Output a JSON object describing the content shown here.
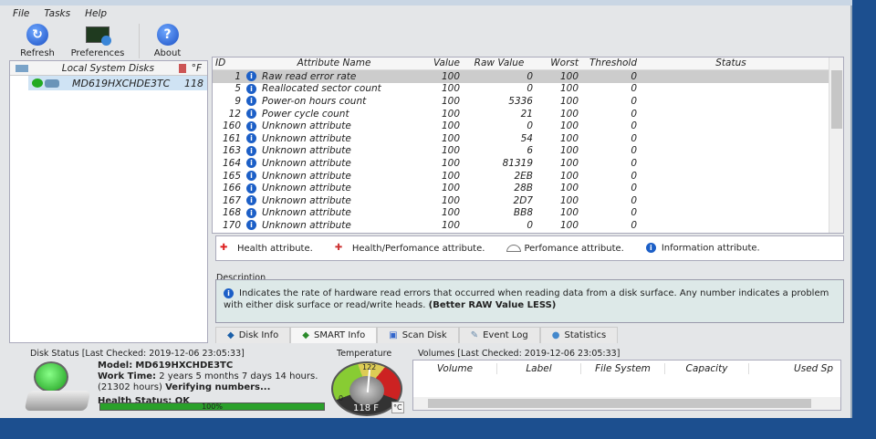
{
  "menu": [
    "File",
    "Tasks",
    "Help"
  ],
  "toolbar": {
    "refresh": "Refresh",
    "preferences": "Preferences",
    "about": "About"
  },
  "disks": {
    "header": "Local System Disks",
    "temp_unit": "°F",
    "items": [
      {
        "name": "MD619HXCHDE3TC",
        "temp": "118"
      }
    ]
  },
  "smart": {
    "columns": [
      "ID",
      "Attribute Name",
      "Value",
      "Raw Value",
      "Worst",
      "Threshold",
      "Status"
    ],
    "rows": [
      [
        "1",
        "Raw read error rate",
        "100",
        "0",
        "100",
        "0"
      ],
      [
        "5",
        "Reallocated sector count",
        "100",
        "0",
        "100",
        "0"
      ],
      [
        "9",
        "Power-on hours count",
        "100",
        "5336",
        "100",
        "0"
      ],
      [
        "12",
        "Power cycle count",
        "100",
        "21",
        "100",
        "0"
      ],
      [
        "160",
        "Unknown attribute",
        "100",
        "0",
        "100",
        "0"
      ],
      [
        "161",
        "Unknown attribute",
        "100",
        "54",
        "100",
        "0"
      ],
      [
        "163",
        "Unknown attribute",
        "100",
        "6",
        "100",
        "0"
      ],
      [
        "164",
        "Unknown attribute",
        "100",
        "81319",
        "100",
        "0"
      ],
      [
        "165",
        "Unknown attribute",
        "100",
        "2EB",
        "100",
        "0"
      ],
      [
        "166",
        "Unknown attribute",
        "100",
        "28B",
        "100",
        "0"
      ],
      [
        "167",
        "Unknown attribute",
        "100",
        "2D7",
        "100",
        "0"
      ],
      [
        "168",
        "Unknown attribute",
        "100",
        "BB8",
        "100",
        "0"
      ],
      [
        "170",
        "Unknown attribute",
        "100",
        "0",
        "100",
        "0"
      ]
    ]
  },
  "legend": [
    "Health attribute.",
    "Health/Perfomance attribute.",
    "Perfomance attribute.",
    "Information attribute."
  ],
  "description": {
    "label": "Description",
    "text": "Indicates the rate of hardware read errors that occurred when reading data from a disk surface. Any number indicates a problem with either disk surface or read/write heads.",
    "bold": "(Better RAW Value LESS)"
  },
  "tabs": [
    "Disk Info",
    "SMART Info",
    "Scan Disk",
    "Event Log",
    "Statistics"
  ],
  "status": {
    "title": "Disk Status [Last Checked: 2019-12-06 23:05:33]",
    "model_label": "Model:",
    "model": "MD619HXCHDE3TC",
    "work_label": "Work Time:",
    "work": "2 years 5 months 7 days 14 hours.",
    "hours": "(21302 hours)",
    "verifying": "Verifying numbers...",
    "health": "Health Status: OK",
    "health_pct": "100%",
    "health_value": 100
  },
  "temperature": {
    "title": "Temperature",
    "reading": "118 F",
    "max": "122",
    "min": "0",
    "unit_button": "°C"
  },
  "volumes": {
    "title": "Volumes [Last Checked: 2019-12-06 23:05:33]",
    "columns": [
      "Volume",
      "Label",
      "File System",
      "Capacity",
      "Used Sp"
    ]
  }
}
